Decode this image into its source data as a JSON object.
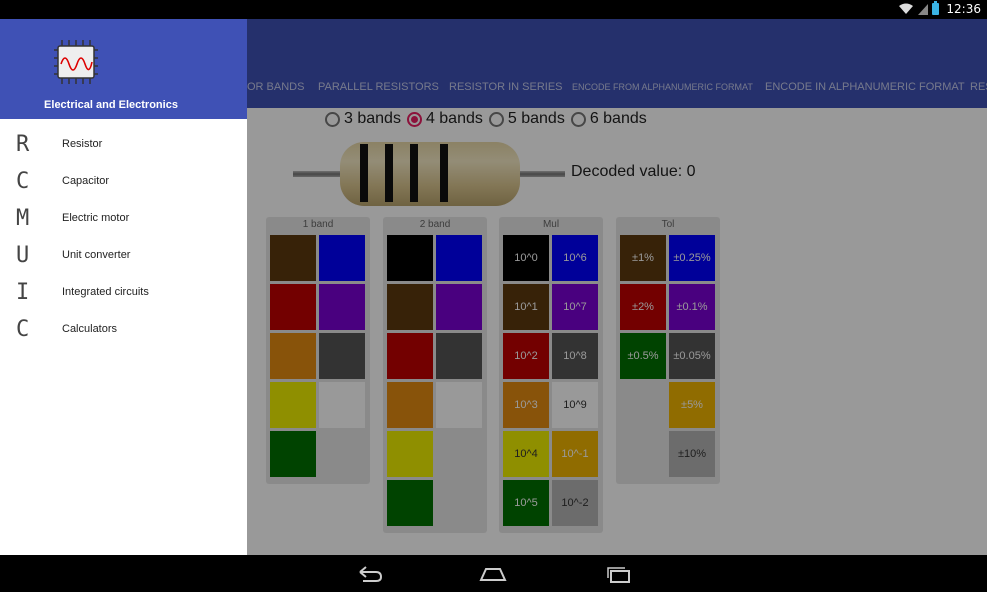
{
  "status": {
    "time": "12:36"
  },
  "tabs": [
    {
      "label": "OR BANDS",
      "small": false
    },
    {
      "label": "PARALLEL RESISTORS",
      "small": false
    },
    {
      "label": "RESISTOR IN SERIES",
      "small": false
    },
    {
      "label": "ENCODE FROM ALPHANUMERIC FORMAT",
      "small": true
    },
    {
      "label": "ENCODE IN ALPHANUMERIC FORMAT",
      "small": false
    },
    {
      "label": "RES",
      "small": false
    }
  ],
  "band_options": [
    {
      "label": "3 bands",
      "checked": false
    },
    {
      "label": "4 bands",
      "checked": true
    },
    {
      "label": "5 bands",
      "checked": false
    },
    {
      "label": "6 bands",
      "checked": false
    }
  ],
  "decoded_label": "Decoded value: 0",
  "panels": [
    {
      "title": "1 band",
      "columns": [
        [
          {
            "color": "#5d3a0e",
            "label": ""
          },
          {
            "color": "#c00000",
            "label": ""
          },
          {
            "color": "#e38a12",
            "label": ""
          },
          {
            "color": "#eeee00",
            "label": ""
          },
          {
            "color": "#007000",
            "label": ""
          }
        ],
        [
          {
            "color": "#0000ff",
            "label": ""
          },
          {
            "color": "#7b00d4",
            "label": ""
          },
          {
            "color": "#555555",
            "label": ""
          },
          {
            "color": "#ffffff",
            "label": ""
          },
          {
            "color": "",
            "label": ""
          }
        ]
      ]
    },
    {
      "title": "2 band",
      "columns": [
        [
          {
            "color": "#000000",
            "label": ""
          },
          {
            "color": "#5d3a0e",
            "label": ""
          },
          {
            "color": "#c00000",
            "label": ""
          },
          {
            "color": "#e38a12",
            "label": ""
          },
          {
            "color": "#eeee00",
            "label": ""
          },
          {
            "color": "#007000",
            "label": ""
          }
        ],
        [
          {
            "color": "#0000ff",
            "label": ""
          },
          {
            "color": "#7b00d4",
            "label": ""
          },
          {
            "color": "#555555",
            "label": ""
          },
          {
            "color": "#ffffff",
            "label": ""
          },
          {
            "color": "",
            "label": ""
          },
          {
            "color": "",
            "label": ""
          }
        ]
      ]
    },
    {
      "title": "Mul",
      "columns": [
        [
          {
            "color": "#000000",
            "label": "10^0"
          },
          {
            "color": "#5d3a0e",
            "label": "10^1"
          },
          {
            "color": "#c00000",
            "label": "10^2"
          },
          {
            "color": "#e38a12",
            "label": "10^3"
          },
          {
            "color": "#eeee00",
            "label": "10^4"
          },
          {
            "color": "#007000",
            "label": "10^5"
          }
        ],
        [
          {
            "color": "#0000ff",
            "label": "10^6"
          },
          {
            "color": "#7b00d4",
            "label": "10^7"
          },
          {
            "color": "#555555",
            "label": "10^8"
          },
          {
            "color": "#ffffff",
            "label": "10^9"
          },
          {
            "color": "#f0b400",
            "label": "10^-1"
          },
          {
            "color": "#b5b5b5",
            "label": "10^-2"
          }
        ]
      ]
    },
    {
      "title": "Tol",
      "columns": [
        [
          {
            "color": "#5d3a0e",
            "label": "±1%"
          },
          {
            "color": "#c00000",
            "label": "±2%"
          },
          {
            "color": "#007000",
            "label": "±0.5%"
          },
          {
            "color": "",
            "label": ""
          },
          {
            "color": "",
            "label": ""
          }
        ],
        [
          {
            "color": "#0000ff",
            "label": "±0.25%"
          },
          {
            "color": "#7b00d4",
            "label": "±0.1%"
          },
          {
            "color": "#555555",
            "label": "±0.05%"
          },
          {
            "color": "#f0b400",
            "label": "±5%"
          },
          {
            "color": "#b5b5b5",
            "label": "±10%"
          }
        ]
      ]
    }
  ],
  "drawer": {
    "title": "Electrical and Electronics",
    "items": [
      {
        "letter": "R",
        "label": "Resistor"
      },
      {
        "letter": "C",
        "label": "Capacitor"
      },
      {
        "letter": "M",
        "label": "Electric motor"
      },
      {
        "letter": "U",
        "label": "Unit converter"
      },
      {
        "letter": "I",
        "label": "Integrated circuits"
      },
      {
        "letter": "C",
        "label": "Calculators"
      }
    ]
  },
  "colors": {
    "primary": "#3f51b5",
    "accent": "#e91e63",
    "tab_text": "#c5cae9"
  },
  "icons": {
    "app": "chip-waveform-icon",
    "back": "back-icon",
    "home": "home-icon",
    "recents": "recents-icon"
  }
}
